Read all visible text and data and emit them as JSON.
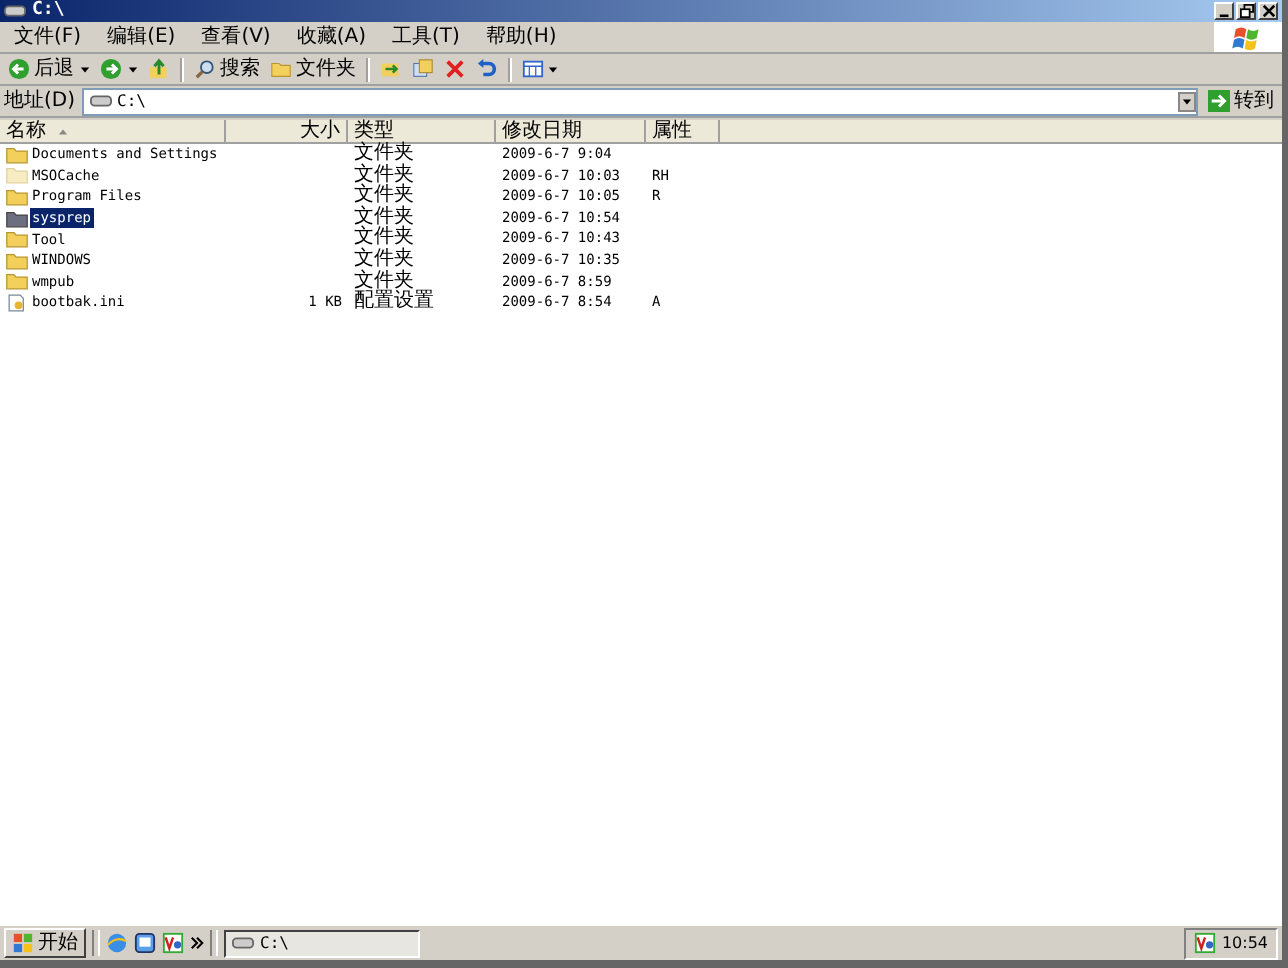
{
  "window": {
    "title": "C:\\"
  },
  "menu": [
    {
      "label": "文件(F)"
    },
    {
      "label": "编辑(E)"
    },
    {
      "label": "查看(V)"
    },
    {
      "label": "收藏(A)"
    },
    {
      "label": "工具(T)"
    },
    {
      "label": "帮助(H)"
    }
  ],
  "toolbar": {
    "back": "后退",
    "search": "搜索",
    "folders": "文件夹"
  },
  "address": {
    "label": "地址(D)",
    "value": "C:\\",
    "go": "转到"
  },
  "columns": [
    {
      "label": "名称",
      "sorted": true
    },
    {
      "label": "大小",
      "sorted": false
    },
    {
      "label": "类型",
      "sorted": false
    },
    {
      "label": "修改日期",
      "sorted": false
    },
    {
      "label": "属性",
      "sorted": false
    }
  ],
  "rows": [
    {
      "kind": "folder",
      "name": "Documents and Settings",
      "size": "",
      "type": "文件夹",
      "date": "2009-6-7 9:04",
      "attr": "",
      "selected": false,
      "hidden": false
    },
    {
      "kind": "folder",
      "name": "MSOCache",
      "size": "",
      "type": "文件夹",
      "date": "2009-6-7 10:03",
      "attr": "RH",
      "selected": false,
      "hidden": true
    },
    {
      "kind": "folder",
      "name": "Program Files",
      "size": "",
      "type": "文件夹",
      "date": "2009-6-7 10:05",
      "attr": "R",
      "selected": false,
      "hidden": false
    },
    {
      "kind": "folder",
      "name": "sysprep",
      "size": "",
      "type": "文件夹",
      "date": "2009-6-7 10:54",
      "attr": "",
      "selected": true,
      "hidden": false
    },
    {
      "kind": "folder",
      "name": "Tool",
      "size": "",
      "type": "文件夹",
      "date": "2009-6-7 10:43",
      "attr": "",
      "selected": false,
      "hidden": false
    },
    {
      "kind": "folder",
      "name": "WINDOWS",
      "size": "",
      "type": "文件夹",
      "date": "2009-6-7 10:35",
      "attr": "",
      "selected": false,
      "hidden": false
    },
    {
      "kind": "folder",
      "name": "wmpub",
      "size": "",
      "type": "文件夹",
      "date": "2009-6-7 8:59",
      "attr": "",
      "selected": false,
      "hidden": false
    },
    {
      "kind": "file",
      "name": "bootbak.ini",
      "size": "1 KB",
      "type": "配置设置",
      "date": "2009-6-7 8:54",
      "attr": "A",
      "selected": false,
      "hidden": false
    }
  ],
  "taskbar": {
    "start": "开始",
    "task": "C:\\",
    "clock": "10:54"
  }
}
